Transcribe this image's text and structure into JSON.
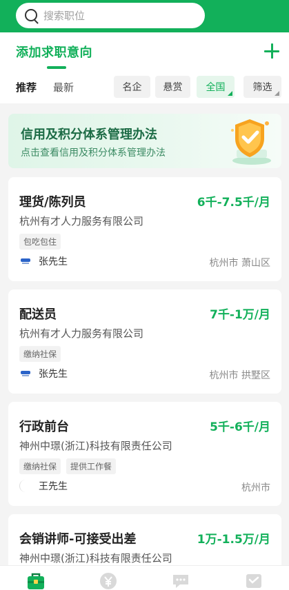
{
  "search": {
    "placeholder": "搜索职位"
  },
  "header": {
    "intent_title": "添加求职意向",
    "tabs": [
      "推荐",
      "最新"
    ],
    "filters": [
      {
        "label": "名企",
        "dropdown": false
      },
      {
        "label": "悬赏",
        "dropdown": false
      },
      {
        "label": "全国",
        "dropdown": true,
        "active": true
      },
      {
        "label": "筛选",
        "dropdown": true
      }
    ]
  },
  "banner": {
    "title": "信用及积分体系管理办法",
    "subtitle": "点击查看信用及积分体系管理办法",
    "icon": "shield-check-icon"
  },
  "jobs": [
    {
      "title": "理货/陈列员",
      "salary": "6千-7.5千/月",
      "company": "杭州有才人力服务有限公司",
      "tags": [
        "包吃包住"
      ],
      "recruiter": "张先生",
      "location": "杭州市 萧山区"
    },
    {
      "title": "配送员",
      "salary": "7千-1万/月",
      "company": "杭州有才人力服务有限公司",
      "tags": [
        "缴纳社保"
      ],
      "recruiter": "张先生",
      "location": "杭州市 拱墅区"
    },
    {
      "title": "行政前台",
      "salary": "5千-6千/月",
      "company": "神州中璟(浙江)科技有限责任公司",
      "tags": [
        "缴纳社保",
        "提供工作餐"
      ],
      "recruiter": "王先生",
      "location": "杭州市"
    },
    {
      "title": "会销讲师-可接受出差",
      "salary": "1万-1.5万/月",
      "company": "神州中璟(浙江)科技有限责任公司",
      "tags": [],
      "recruiter": "",
      "location": ""
    }
  ],
  "bottom_nav": [
    {
      "icon": "briefcase-icon",
      "active": true
    },
    {
      "icon": "yen-icon"
    },
    {
      "icon": "chat-icon"
    },
    {
      "icon": "profile-icon"
    }
  ],
  "colors": {
    "brand": "#12b05a",
    "background": "#f4f4f4"
  }
}
